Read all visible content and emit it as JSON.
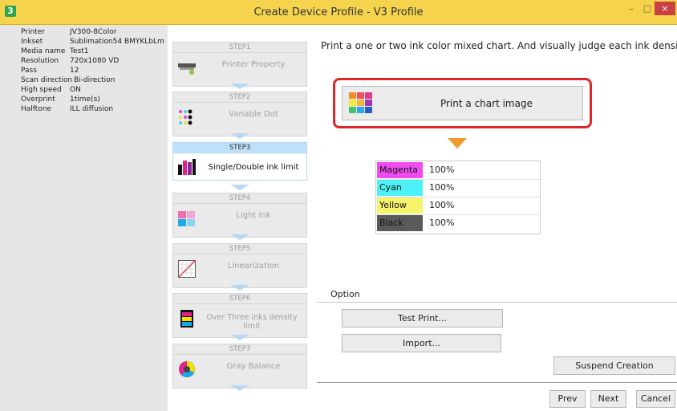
{
  "window": {
    "title": "Create Device Profile - V3 Profile",
    "app_icon_glyph": "3",
    "minimize_glyph": "–",
    "maximize_glyph": "□",
    "close_glyph": "×"
  },
  "info": [
    {
      "key": "Printer",
      "value": "JV300-8Color"
    },
    {
      "key": "Inkset",
      "value": "Sublimation54 BMYKLbLm"
    },
    {
      "key": "Media name",
      "value": "Test1"
    },
    {
      "key": "Resolution",
      "value": "720x1080 VD"
    },
    {
      "key": "Pass",
      "value": "12"
    },
    {
      "key": "Scan direction",
      "value": "Bi-direction"
    },
    {
      "key": "High speed",
      "value": "ON"
    },
    {
      "key": "Overprint",
      "value": "1time(s)"
    },
    {
      "key": "Halftone",
      "value": "ILL diffusion"
    }
  ],
  "steps": [
    {
      "header": "STEP1",
      "label": "Printer Property",
      "icon": "printer-icon"
    },
    {
      "header": "STEP2",
      "label": "Variable Dot",
      "icon": "dots-icon"
    },
    {
      "header": "STEP3",
      "label": "Single/Double ink limit",
      "icon": "ink-bars-icon",
      "active": true
    },
    {
      "header": "STEP4",
      "label": "Light Ink",
      "icon": "light-ink-icon"
    },
    {
      "header": "STEP5",
      "label": "Linearization",
      "icon": "linearization-icon"
    },
    {
      "header": "STEP6",
      "label": "Over Three inks density limit",
      "icon": "density-icon"
    },
    {
      "header": "STEP7",
      "label": "Gray Balance",
      "icon": "gray-balance-icon"
    }
  ],
  "main": {
    "instruction": "Print a one or two ink color mixed chart. And visually judge each ink density.",
    "print_chart_label": "Print a chart image",
    "inks": [
      {
        "name": "Magenta",
        "value": "100%",
        "color": "#f04bf0"
      },
      {
        "name": "Cyan",
        "value": "100%",
        "color": "#4cf2f7"
      },
      {
        "name": "Yellow",
        "value": "100%",
        "color": "#f6f36c"
      },
      {
        "name": "Black",
        "value": "100%",
        "color": "#5a5a5a"
      }
    ],
    "option_label": "Option",
    "test_print_label": "Test Print...",
    "import_label": "Import...",
    "suspend_label": "Suspend Creation",
    "prev_label": "Prev",
    "next_label": "Next",
    "cancel_label": "Cancel"
  }
}
